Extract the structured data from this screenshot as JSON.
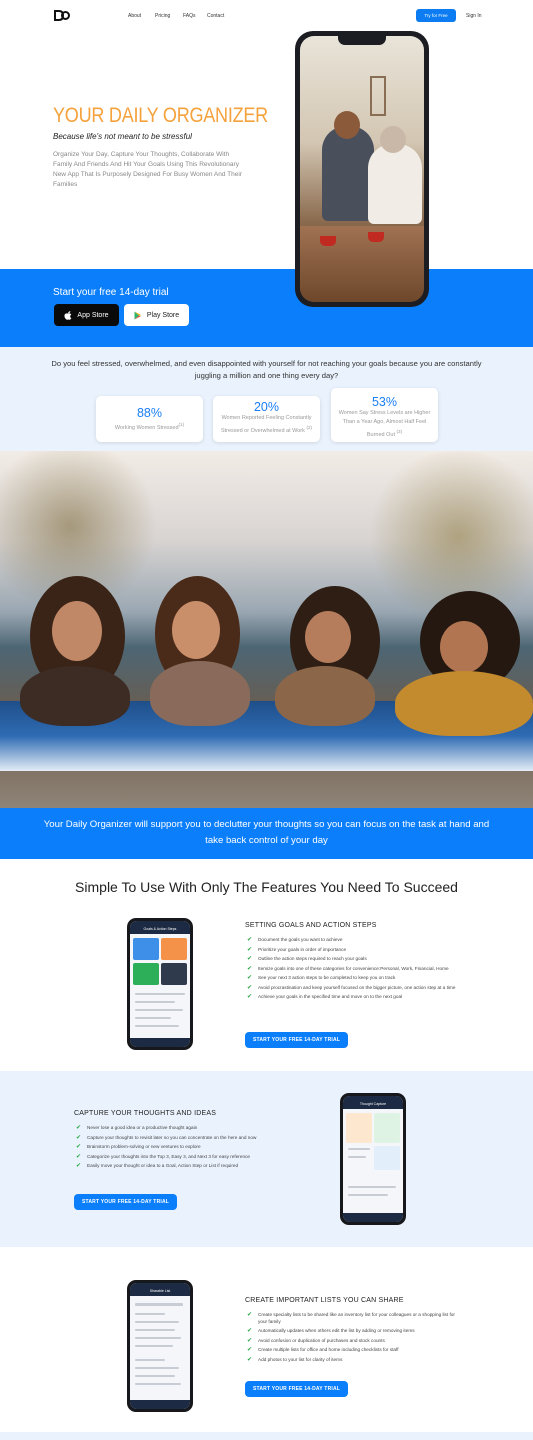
{
  "nav": {
    "logo_text": "DO",
    "links": [
      "About",
      "Pricing",
      "FAQs",
      "Contact"
    ],
    "cta": "Try for Free",
    "signin": "Sign In"
  },
  "hero": {
    "title": "YOUR DAILY ORGANIZER",
    "subtitle": "Because life's not meant to be stressful",
    "description": "Organize Your Day, Capture Your Thoughts, Collaborate With Family And Friends And Hit Your Goals Using This Revolutionary New App That Is Purposely Designed For Busy Women And Their Families",
    "trial_text": "Start your free 14-day trial",
    "app_store": "App Store",
    "play_store": "Play Store"
  },
  "stress": {
    "question": "Do you feel stressed, overwhelmed, and even disappointed with yourself for not reaching your goals because you are constantly juggling a million and one thing every day?",
    "stats": [
      {
        "value": "88%",
        "label": "Working Women Stressed",
        "ref": "(1)"
      },
      {
        "value": "20%",
        "label": "Women Reported Feeling Constantly Stressed or Overwhelmed at Work",
        "ref": "(2)"
      },
      {
        "value": "53%",
        "label": "Women Say Stress Levels are Higher Than a Year Ago, Almost Half Feel Burned Out",
        "ref": "(3)"
      }
    ]
  },
  "support": {
    "text": "Your Daily Organizer will support you to declutter your thoughts so you can focus on the task at hand and take back control of your day"
  },
  "features": {
    "title": "Simple To Use With Only The Features You Need To Succeed",
    "sections": [
      {
        "heading": "SETTING GOALS AND ACTION STEPS",
        "items": [
          "Document the goals you want to achieve",
          "Prioritize your goals in order of importance",
          "Outline the action steps required to reach your goals",
          "Itemize goals into one of these categories for convenience:Personal, Work, Financial, Home",
          "See your next 3 action steps to be completed to keep you on track",
          "Avoid procrastination and keep yourself focused on the bigger picture, one action step at a time",
          "Achieve your goals in the specified time and move on to the next goal"
        ],
        "cta": "START YOUR FREE 14-DAY TRIAL",
        "screen_title": "Goals & Action Steps"
      },
      {
        "heading": "CAPTURE YOUR THOUGHTS AND IDEAS",
        "items": [
          "Never lose a good idea or a productive thought again",
          "Capture your thoughts to revisit later so you can concentrate on the here and now",
          "Brainstorm problem-solving or new ventures to explore",
          "Categorize your thoughts into the Top 3, Easy 3, and Next 3 for easy reference",
          "Easily move your thought or idea to a Goal, Action Step or List if required"
        ],
        "cta": "START YOUR FREE 14-DAY TRIAL",
        "screen_title": "Thought Capture"
      },
      {
        "heading": "CREATE IMPORTANT LISTS YOU CAN SHARE",
        "items": [
          "Create specialty lists to be shared like an inventory list for your colleagues or a shopping list for your family",
          "Automatically updates when others edit the list by adding or removing items",
          "Avoid confusion or duplication of purchases and stock counts",
          "Create multiple lists for office and home including checklists for staff",
          "Add photos to your list for clarity of items"
        ],
        "cta": "START YOUR FREE 14-DAY TRIAL",
        "screen_title": "Sharable List"
      }
    ]
  },
  "colors": {
    "brand_blue": "#0b7ffb",
    "accent_orange": "#f5a23c",
    "check_green": "#2aa844"
  }
}
